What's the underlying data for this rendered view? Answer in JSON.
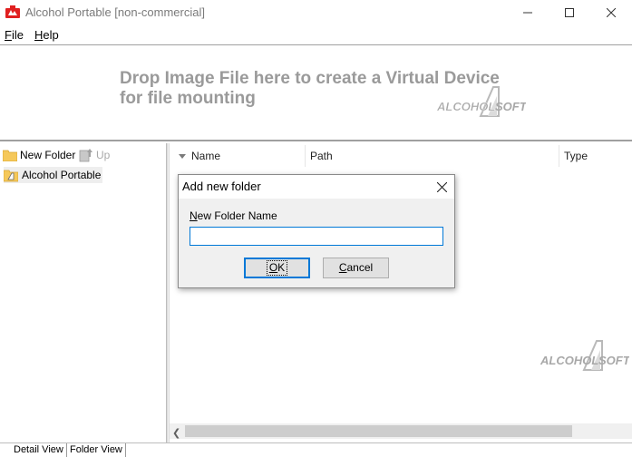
{
  "window": {
    "title": "Alcohol Portable  [non-commercial]",
    "icon": "alcohol-app-icon"
  },
  "menu": {
    "file_first": "F",
    "file_rest": "ile",
    "help_first": "H",
    "help_rest": "elp"
  },
  "dropzone": {
    "line1": "Drop Image File here to create a Virtual Device",
    "line2": "for file mounting",
    "logo_text": "ALCOHOL SOFT"
  },
  "left_toolbar": {
    "new_folder": "New Folder",
    "up": "Up"
  },
  "tree": {
    "root": "Alcohol Portable"
  },
  "list": {
    "columns": [
      "Name",
      "Path",
      "Type"
    ]
  },
  "tabs": {
    "detail": "Detail View",
    "folder": "Folder View"
  },
  "dialog": {
    "title": "Add new folder",
    "label_first": "N",
    "label_rest": "ew Folder Name",
    "input_value": "",
    "ok_first": "O",
    "ok_rest": "K",
    "cancel_first": "C",
    "cancel_rest": "ancel"
  },
  "colors": {
    "accent": "#0078d7",
    "drop_text": "#9a9a9a",
    "app_icon": "#e02020"
  }
}
